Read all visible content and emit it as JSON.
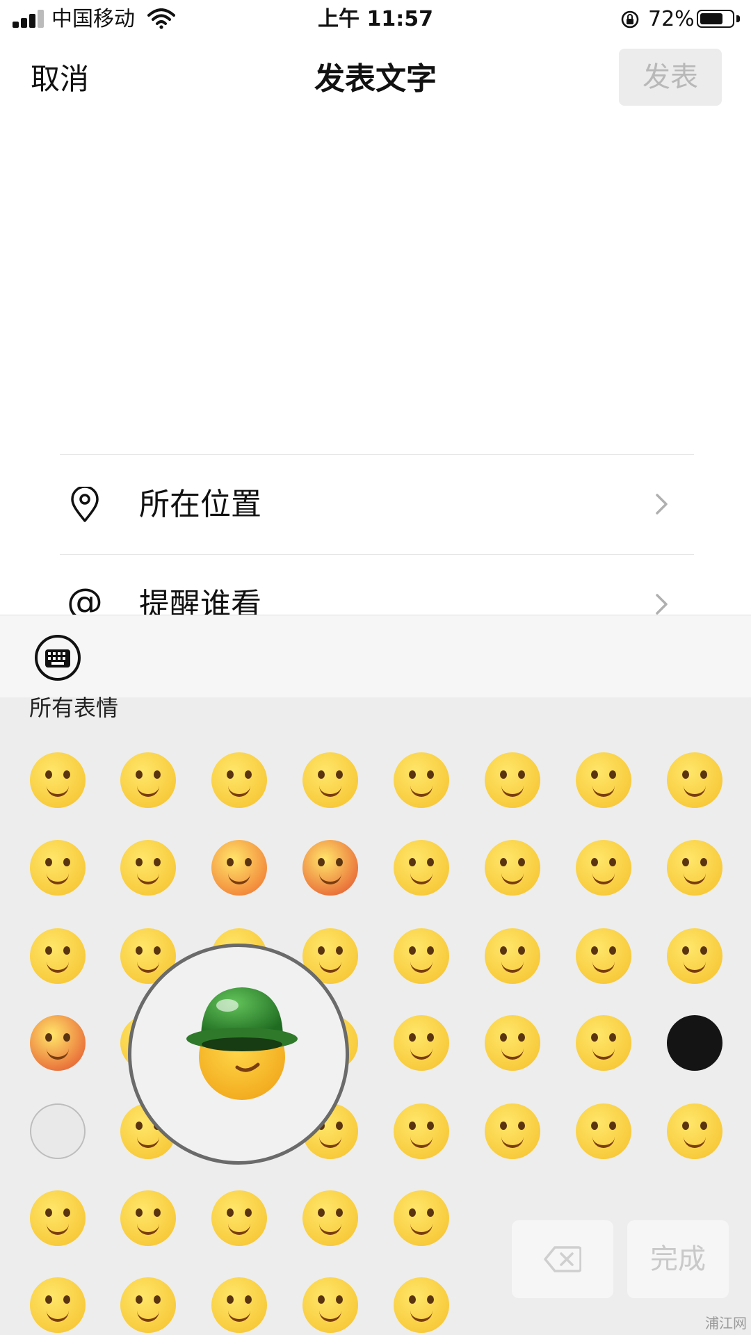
{
  "status_bar": {
    "carrier": "中国移动",
    "time": "上午 11:57",
    "battery_percent": "72%",
    "battery_level": 0.72,
    "icons": [
      "signal-icon",
      "wifi-icon",
      "rotation-lock-icon",
      "battery-icon"
    ]
  },
  "nav": {
    "cancel": "取消",
    "title": "发表文字",
    "publish": "发表"
  },
  "rows": [
    {
      "label": "所在位置",
      "icon": "location-pin-icon"
    },
    {
      "label": "提醒谁看",
      "icon": "at-sign-icon"
    }
  ],
  "emoji_panel": {
    "toolbar_icon": "keyboard-icon",
    "section_title": "所有表情",
    "magnified_emoji": "green-helmet-emoji",
    "delete_icon": "backspace-icon",
    "done_label": "完成"
  },
  "watermark": "浦江网",
  "colors": {
    "emoji_yellow": "#f5c02a",
    "emoji_orange": "#ee6a2c",
    "emoji_red": "#e24a2a",
    "panel_bg": "#ededed",
    "disabled_text": "#b8b8b8"
  }
}
